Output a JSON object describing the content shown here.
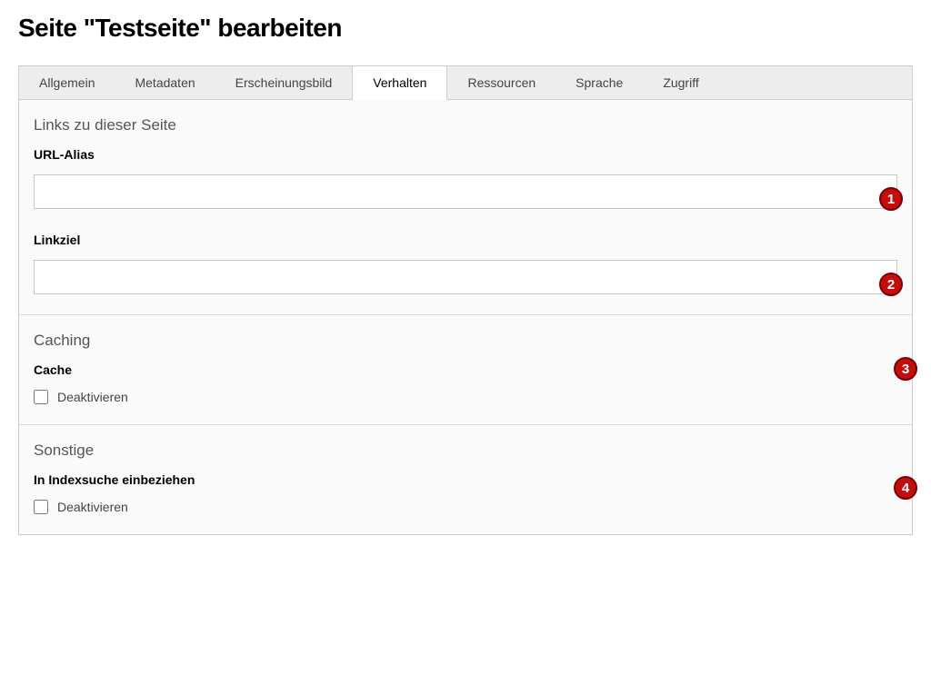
{
  "page": {
    "title": "Seite \"Testseite\" bearbeiten"
  },
  "tabs": {
    "items": [
      "Allgemein",
      "Metadaten",
      "Erscheinungsbild",
      "Verhalten",
      "Ressourcen",
      "Sprache",
      "Zugriff"
    ],
    "active_index": 3
  },
  "sections": {
    "links": {
      "heading": "Links zu dieser Seite",
      "url_alias_label": "URL-Alias",
      "url_alias_value": "",
      "linkziel_label": "Linkziel",
      "linkziel_value": ""
    },
    "caching": {
      "heading": "Caching",
      "cache_label": "Cache",
      "checkbox_label": "Deaktivieren",
      "checkbox_checked": false
    },
    "sonstige": {
      "heading": "Sonstige",
      "index_label": "In Indexsuche einbeziehen",
      "checkbox_label": "Deaktivieren",
      "checkbox_checked": false
    }
  },
  "annotations": {
    "badge1": "1",
    "badge2": "2",
    "badge3": "3",
    "badge4": "4"
  }
}
